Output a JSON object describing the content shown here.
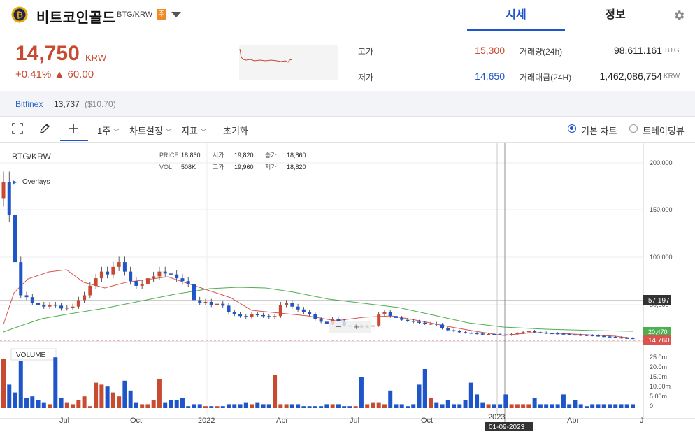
{
  "header": {
    "coin_name": "비트코인골드",
    "pair": "BTG/KRW",
    "badge": "주",
    "tabs": [
      {
        "label": "시세",
        "active": true
      },
      {
        "label": "정보",
        "active": false
      }
    ],
    "logo_icon": "bitcoin-gold-logo-icon",
    "settings_icon": "gear-icon"
  },
  "summary": {
    "price": "14,750",
    "currency": "KRW",
    "change_pct": "+0.41%",
    "change_arrow": "▲",
    "change_abs": "60.00",
    "high_label": "고가",
    "high": "15,300",
    "low_label": "저가",
    "low": "14,650",
    "volume_label": "거래량(24h)",
    "volume": "98,611.161",
    "volume_unit": "BTG",
    "amount_label": "거래대금(24H)",
    "amount": "1,462,086,754",
    "amount_unit": "KRW",
    "up_color": "#c84a31",
    "down_color": "#1e55c8"
  },
  "exchange": {
    "name": "Bitfinex",
    "price": "13,737",
    "usd": "($10.70)"
  },
  "toolbar": {
    "interval": "1주",
    "chart_settings": "차트설정",
    "indicators": "지표",
    "reset": "초기화",
    "basic_chart": "기본 차트",
    "tradingview": "트레이딩뷰"
  },
  "legend": {
    "symbol": "BTG/KRW",
    "overlays": "Overlays",
    "price_label": "PRICE",
    "price": "18,860",
    "vol_label": "VOL",
    "vol": "508K",
    "open_label": "시가",
    "open": "19,820",
    "high_label": "고가",
    "high": "19,960",
    "close_label": "종가",
    "close": "18,860",
    "low_label": "저가",
    "low": "18,820",
    "volume_title": "VOLUME"
  },
  "chart_data": {
    "type": "candlestick",
    "price_axis_ticks": [
      200000,
      150000,
      100000,
      50000
    ],
    "price_axis_labels": [
      "200,000",
      "150,000",
      "100,000",
      "50,000"
    ],
    "ylim": [
      0,
      218000
    ],
    "volume_axis_labels": [
      "25.0m",
      "20.0m",
      "15.0m",
      "10.00m",
      "5.00m",
      "0"
    ],
    "volume_ylim": [
      0,
      28
    ],
    "x_ticks": [
      "Jul",
      "Oct",
      "2022",
      "Apr",
      "Jul",
      "Oct",
      "2023",
      "Apr",
      "J"
    ],
    "crosshair_price": "57,197",
    "crosshair_date": "01-09-2023",
    "last_price_tag": "14,760",
    "ma_tag": "20,470",
    "closes": [
      180000,
      145000,
      95000,
      60000,
      58000,
      52000,
      50000,
      48000,
      50000,
      49000,
      46000,
      47000,
      48000,
      55000,
      60000,
      70000,
      78000,
      85000,
      82000,
      90000,
      95000,
      85000,
      75000,
      70000,
      72000,
      78000,
      80000,
      85000,
      83000,
      82000,
      78000,
      75000,
      72000,
      55000,
      52000,
      53000,
      50000,
      51000,
      49000,
      42000,
      40000,
      38000,
      37000,
      40000,
      39000,
      38000,
      37000,
      38000,
      50000,
      52000,
      48000,
      45000,
      42000,
      40000,
      35000,
      32000,
      30000,
      35000,
      33000,
      28000,
      27000,
      28000,
      26000,
      27000,
      28000,
      40000,
      42000,
      38000,
      36000,
      34000,
      33000,
      32000,
      31000,
      30000,
      30000,
      29000,
      25000,
      23000,
      22000,
      21000,
      20500,
      20000,
      19500,
      19000,
      19000,
      18800,
      18500,
      18000,
      19000,
      20000,
      21000,
      22000,
      21000,
      20500,
      20000,
      19800,
      19500,
      19000,
      18500,
      18200,
      18000,
      17800,
      17500,
      17000,
      16500,
      16000,
      15500,
      15000,
      14800,
      14760
    ],
    "volumes": [
      25,
      12,
      8,
      24,
      5,
      6,
      4,
      3,
      2,
      26,
      5,
      3,
      2,
      4,
      6,
      1,
      13,
      12,
      11,
      8,
      6,
      14,
      9,
      3,
      2,
      2,
      4,
      15,
      3,
      4,
      4,
      5,
      1,
      2,
      2,
      1,
      1,
      1,
      1,
      2,
      2,
      2,
      3,
      2,
      3,
      2,
      2,
      17,
      2,
      2,
      2,
      2,
      1,
      1,
      1,
      1,
      2,
      2,
      2,
      1,
      1,
      1,
      16,
      2,
      3,
      3,
      2,
      9,
      2,
      2,
      1,
      2,
      12,
      20,
      5,
      3,
      2,
      4,
      2,
      2,
      4,
      13,
      7,
      3,
      2,
      2,
      2,
      7,
      2,
      2,
      2,
      2,
      5,
      2,
      2,
      2,
      2,
      7,
      2,
      4,
      2,
      1,
      2,
      2,
      2,
      2,
      2,
      2,
      2,
      2
    ],
    "vol_colors": "mixed"
  }
}
